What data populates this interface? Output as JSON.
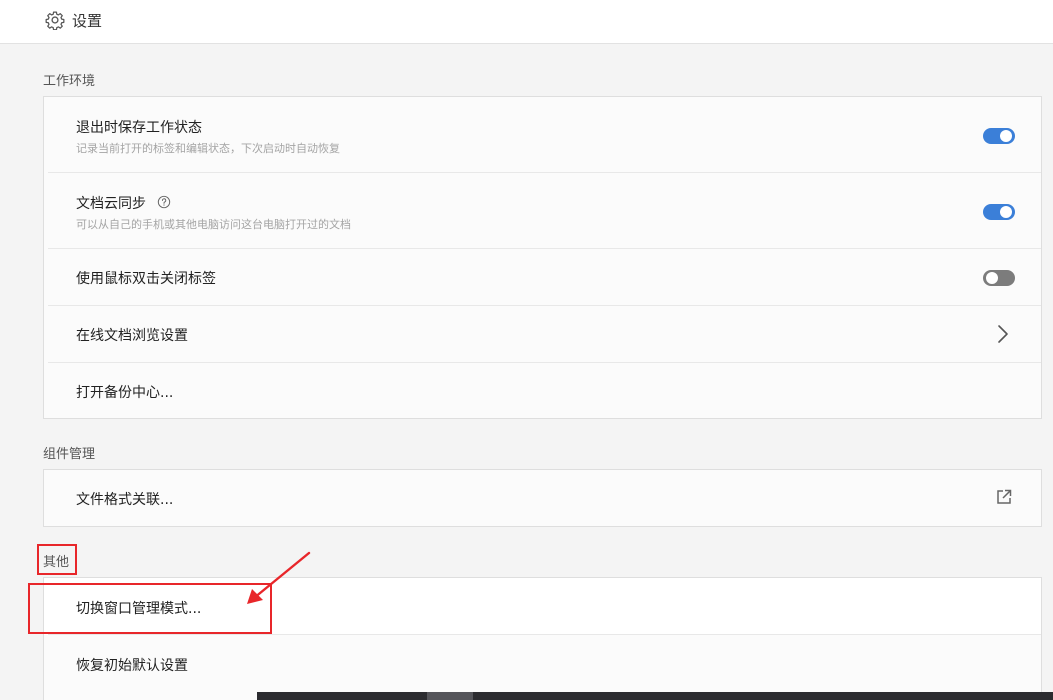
{
  "header": {
    "icon": "gear-icon",
    "title": "设置"
  },
  "sections": {
    "workspace": {
      "label": "工作环境",
      "items": [
        {
          "label": "退出时保存工作状态",
          "desc": "记录当前打开的标签和编辑状态，下次启动时自动恢复",
          "control": "toggle",
          "state": "on"
        },
        {
          "label": "文档云同步",
          "desc": "可以从自己的手机或其他电脑访问这台电脑打开过的文档",
          "control": "toggle",
          "state": "on",
          "icon": "help-circle-icon"
        },
        {
          "label": "使用鼠标双击关闭标签",
          "control": "toggle",
          "state": "off"
        },
        {
          "label": "在线文档浏览设置",
          "control": "chevron-right-icon"
        },
        {
          "label": "打开备份中心..."
        }
      ]
    },
    "components": {
      "label": "组件管理",
      "items": [
        {
          "label": "文件格式关联...",
          "control": "external-link-icon"
        }
      ]
    },
    "other": {
      "label": "其他",
      "items": [
        {
          "label": "切换窗口管理模式..."
        },
        {
          "label": "恢复初始默认设置"
        }
      ]
    }
  },
  "colors": {
    "toggle_on": "#3b7fd8",
    "toggle_off": "#7c7c7c",
    "annotation_red": "#e8262a"
  }
}
